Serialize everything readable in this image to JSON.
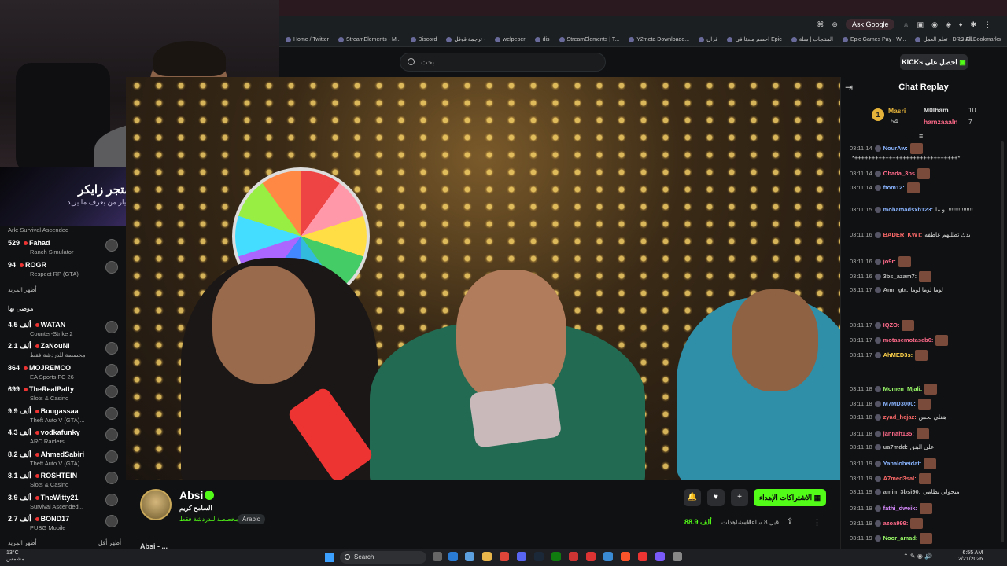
{
  "promo": {
    "line1": "متجر زايكر",
    "line2": "خيار من يعرف ما يريد"
  },
  "browser": {
    "ask_google": "Ask Google",
    "bookmarks": [
      "Home / Twitter",
      "StreamElements - M...",
      "Discord",
      "ترجمة قوقل -",
      "welpeper",
      "dis",
      "StreamElements | T...",
      "Y2meta Downloade...",
      "قران",
      "احصم مبدئا في Epic",
      "المنتجات | سلة",
      "Epic Games Pay - W...",
      "تعلم العمل - DRB-El..."
    ],
    "all_bookmarks": "All Bookmarks"
  },
  "site": {
    "search_placeholder": "بحث",
    "kicks_prefix": "KICKs",
    "kicks_label": "احصل على"
  },
  "sidebar": {
    "top_game": "Ark: Survival Ascended",
    "items_top": [
      {
        "count": "529",
        "name": "Fahad",
        "game": "Ranch Simulator"
      },
      {
        "count": "94",
        "name": "ROGR",
        "game": "Respect RP (GTA)"
      }
    ],
    "show_more_1": "أظهر المزيد",
    "recommended": "موصى بها",
    "items": [
      {
        "count": "4.5 ألف",
        "name": "WATAN",
        "game": "Counter-Strike 2"
      },
      {
        "count": "2.1 ألف",
        "name": "ZaNouNi",
        "game": "مخصصة للدردشة فقط"
      },
      {
        "count": "864",
        "name": "MOJREMCO",
        "game": "EA Sports FC 26"
      },
      {
        "count": "699",
        "name": "TheRealPatty",
        "game": "Slots & Casino"
      },
      {
        "count": "9.9 ألف",
        "name": "Bougassaa",
        "game": "Theft Auto V (GTA)..."
      },
      {
        "count": "4.3 ألف",
        "name": "vodkafunky",
        "game": "ARC Raiders"
      },
      {
        "count": "8.2 ألف",
        "name": "AhmedSabiri",
        "game": "Theft Auto V (GTA)..."
      },
      {
        "count": "8.1 ألف",
        "name": "ROSHTEIN",
        "game": "Slots & Casino"
      },
      {
        "count": "3.9 ألف",
        "name": "TheWitty21",
        "game": "Survival Ascended..."
      },
      {
        "count": "2.7 ألف",
        "name": "BOND17",
        "game": "PUBG Mobile"
      }
    ],
    "show_more_2": "أظهر المزيد",
    "show_less": "أظهر أقل"
  },
  "channel": {
    "name": "Absi",
    "title": "السامح كريم",
    "category": "مخصصة للدردشة فقط",
    "language": "Arabic",
    "subscribe": "الاشتراكات الإهداء",
    "viewers": "88.9 ألف",
    "viewers_label": "المشاهدات",
    "ago": "قبل 8 ساعات",
    "below": "Absi - ..."
  },
  "chat": {
    "title": "Chat Replay",
    "leaders": [
      {
        "name": "Masri",
        "n": "54"
      },
      {
        "name": "M0lham",
        "n": "10"
      },
      {
        "name": "hamzaaaln",
        "n": "7"
      }
    ],
    "messages": [
      {
        "ts": "03:11:14",
        "user": "NourAw:",
        "color": "#8ab4ff",
        "text": ""
      },
      {
        "ts": "",
        "user": "",
        "color": "#ddd",
        "text": "*++++++++++++++++++++++++++++++*"
      },
      {
        "ts": "03:11:14",
        "user": "Obada_3bs",
        "color": "#ff6a8a",
        "text": ""
      },
      {
        "ts": "03:11:14",
        "user": "ftom12:",
        "color": "#8ab4ff",
        "text": ""
      },
      {
        "ts": "03:11:15",
        "user": "mohamadsxb123:",
        "color": "#8ab4ff",
        "text": "لو ما !!!!!!!!!!!!!!!"
      },
      {
        "ts": "03:11:16",
        "user": "BADER_KWT:",
        "color": "#ff6a6a",
        "text": "بدك تطلبهم عاطفه"
      },
      {
        "ts": "03:11:16",
        "user": "jo9r:",
        "color": "#ff6a8a",
        "text": ""
      },
      {
        "ts": "03:11:16",
        "user": "3bs_azam7:",
        "color": "#bbbbbb",
        "text": ""
      },
      {
        "ts": "03:11:17",
        "user": "Amr_gtr:",
        "color": "#bbbbbb",
        "text": "لوما لوما لوما"
      },
      {
        "ts": "03:11:17",
        "user": "IQZO:",
        "color": "#ff6a8a",
        "text": ""
      },
      {
        "ts": "03:11:17",
        "user": "motasemotaseb6:",
        "color": "#ff6a8a",
        "text": ""
      },
      {
        "ts": "03:11:17",
        "user": "AhMED3s:",
        "color": "#ffd24a",
        "text": ""
      },
      {
        "ts": "03:11:18",
        "user": "Momen_Mjali:",
        "color": "#9dff6a",
        "text": ""
      },
      {
        "ts": "03:11:18",
        "user": "M7MD3000:",
        "color": "#8ab4ff",
        "text": ""
      },
      {
        "ts": "03:11:18",
        "user": "zyad_hejaz:",
        "color": "#ff6a6a",
        "text": "هقلي لحس"
      },
      {
        "ts": "03:11:18",
        "user": "jannah135:",
        "color": "#ff6a8a",
        "text": ""
      },
      {
        "ts": "03:11:18",
        "user": "ua7mdd:",
        "color": "#bbbbbb",
        "text": "علي البنق"
      },
      {
        "ts": "03:11:19",
        "user": "Yanalobeidat:",
        "color": "#8ab4ff",
        "text": ""
      },
      {
        "ts": "03:11:19",
        "user": "A7med3sal:",
        "color": "#ff6a6a",
        "text": ""
      },
      {
        "ts": "03:11:19",
        "user": "amin_3bsi90:",
        "color": "#bbbbbb",
        "text": "متحولي نظامي"
      },
      {
        "ts": "03:11:19",
        "user": "fathi_dweik:",
        "color": "#d98aff",
        "text": ""
      },
      {
        "ts": "03:11:19",
        "user": "azoa999:",
        "color": "#ff6a8a",
        "text": ""
      },
      {
        "ts": "03:11:19",
        "user": "Noor_amad:",
        "color": "#9dff6a",
        "text": ""
      }
    ]
  },
  "taskbar": {
    "weather_temp": "13°C",
    "weather_desc": "مشمس",
    "search": "Search",
    "time": "6:55 AM",
    "date": "2/21/2026"
  }
}
